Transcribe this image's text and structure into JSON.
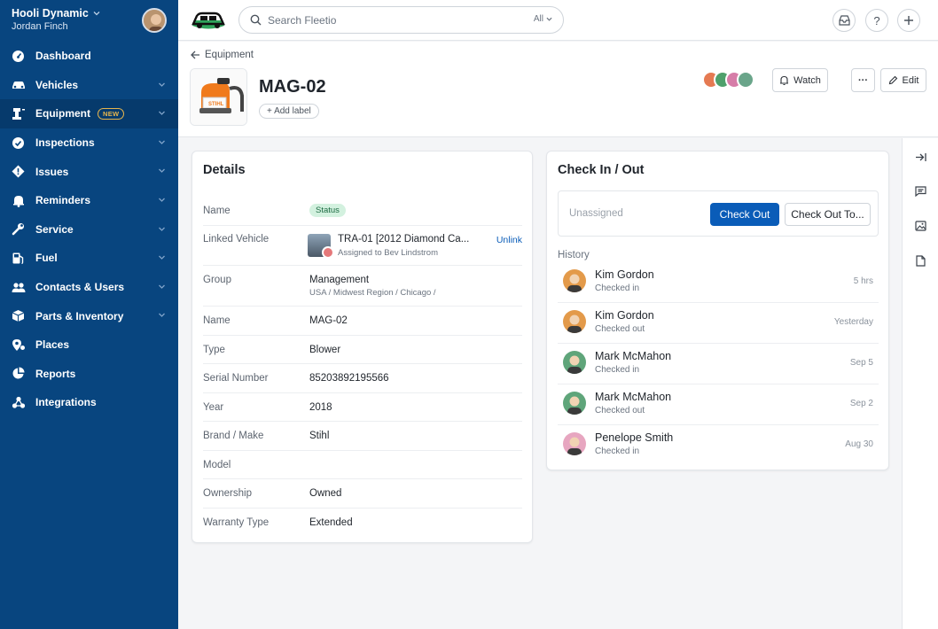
{
  "org": {
    "name": "Hooli Dynamic",
    "user": "Jordan Finch"
  },
  "nav": [
    {
      "label": "Dashboard",
      "icon": "dashboard-icon",
      "chevron": false
    },
    {
      "label": "Vehicles",
      "icon": "car-icon",
      "chevron": true
    },
    {
      "label": "Equipment",
      "icon": "equipment-icon",
      "chevron": true,
      "badge": "NEW",
      "active": true
    },
    {
      "label": "Inspections",
      "icon": "check-circle-icon",
      "chevron": true
    },
    {
      "label": "Issues",
      "icon": "issue-diamond-icon",
      "chevron": true
    },
    {
      "label": "Reminders",
      "icon": "bell-icon",
      "chevron": true
    },
    {
      "label": "Service",
      "icon": "wrench-icon",
      "chevron": true
    },
    {
      "label": "Fuel",
      "icon": "fuel-icon",
      "chevron": true
    },
    {
      "label": "Contacts & Users",
      "icon": "users-icon",
      "chevron": true
    },
    {
      "label": "Parts & Inventory",
      "icon": "box-icon",
      "chevron": true
    },
    {
      "label": "Places",
      "icon": "places-icon",
      "chevron": false
    },
    {
      "label": "Reports",
      "icon": "pie-icon",
      "chevron": false
    },
    {
      "label": "Integrations",
      "icon": "integrations-icon",
      "chevron": false
    }
  ],
  "search": {
    "placeholder": "Search Fleetio",
    "scope": "All"
  },
  "header": {
    "back": "Equipment",
    "title": "MAG-02",
    "add_label": "+ Add label",
    "watch": "Watch",
    "more": "···",
    "edit": "Edit"
  },
  "details": {
    "title": "Details",
    "rows": [
      {
        "key": "Name",
        "status": "Status"
      },
      {
        "key": "Linked Vehicle",
        "value": "TRA-01 [2012 Diamond Ca...",
        "sub": "Assigned to Bev Lindstrom",
        "action": "Unlink"
      },
      {
        "key": "Group",
        "value": "Management",
        "sub": "USA / Midwest Region / Chicago /"
      },
      {
        "key": "Name",
        "value": "MAG-02"
      },
      {
        "key": "Type",
        "value": "Blower"
      },
      {
        "key": "Serial Number",
        "value": "85203892195566"
      },
      {
        "key": "Year",
        "value": "2018"
      },
      {
        "key": "Brand / Make",
        "value": "Stihl"
      },
      {
        "key": "Model",
        "value": ""
      },
      {
        "key": "Ownership",
        "value": "Owned"
      },
      {
        "key": "Warranty Type",
        "value": "Extended"
      }
    ]
  },
  "checkin": {
    "title": "Check In / Out",
    "unassigned": "Unassigned",
    "check_out": "Check Out",
    "check_out_to": "Check Out To...",
    "history_label": "History",
    "history": [
      {
        "name": "Kim Gordon",
        "action": "Checked in",
        "time": "5 hrs",
        "color": "#e39a4a"
      },
      {
        "name": "Kim Gordon",
        "action": "Checked out",
        "time": "Yesterday",
        "color": "#e39a4a"
      },
      {
        "name": "Mark McMahon",
        "action": "Checked in",
        "time": "Sep 5",
        "color": "#5fa57a"
      },
      {
        "name": "Mark McMahon",
        "action": "Checked out",
        "time": "Sep 2",
        "color": "#5fa57a"
      },
      {
        "name": "Penelope Smith",
        "action": "Checked in",
        "time": "Aug 30",
        "color": "#e7a6c0"
      }
    ]
  },
  "colors": {
    "sidebar": "#08457f",
    "primary": "#0a5cb8",
    "status_bg": "#d3f1df"
  }
}
